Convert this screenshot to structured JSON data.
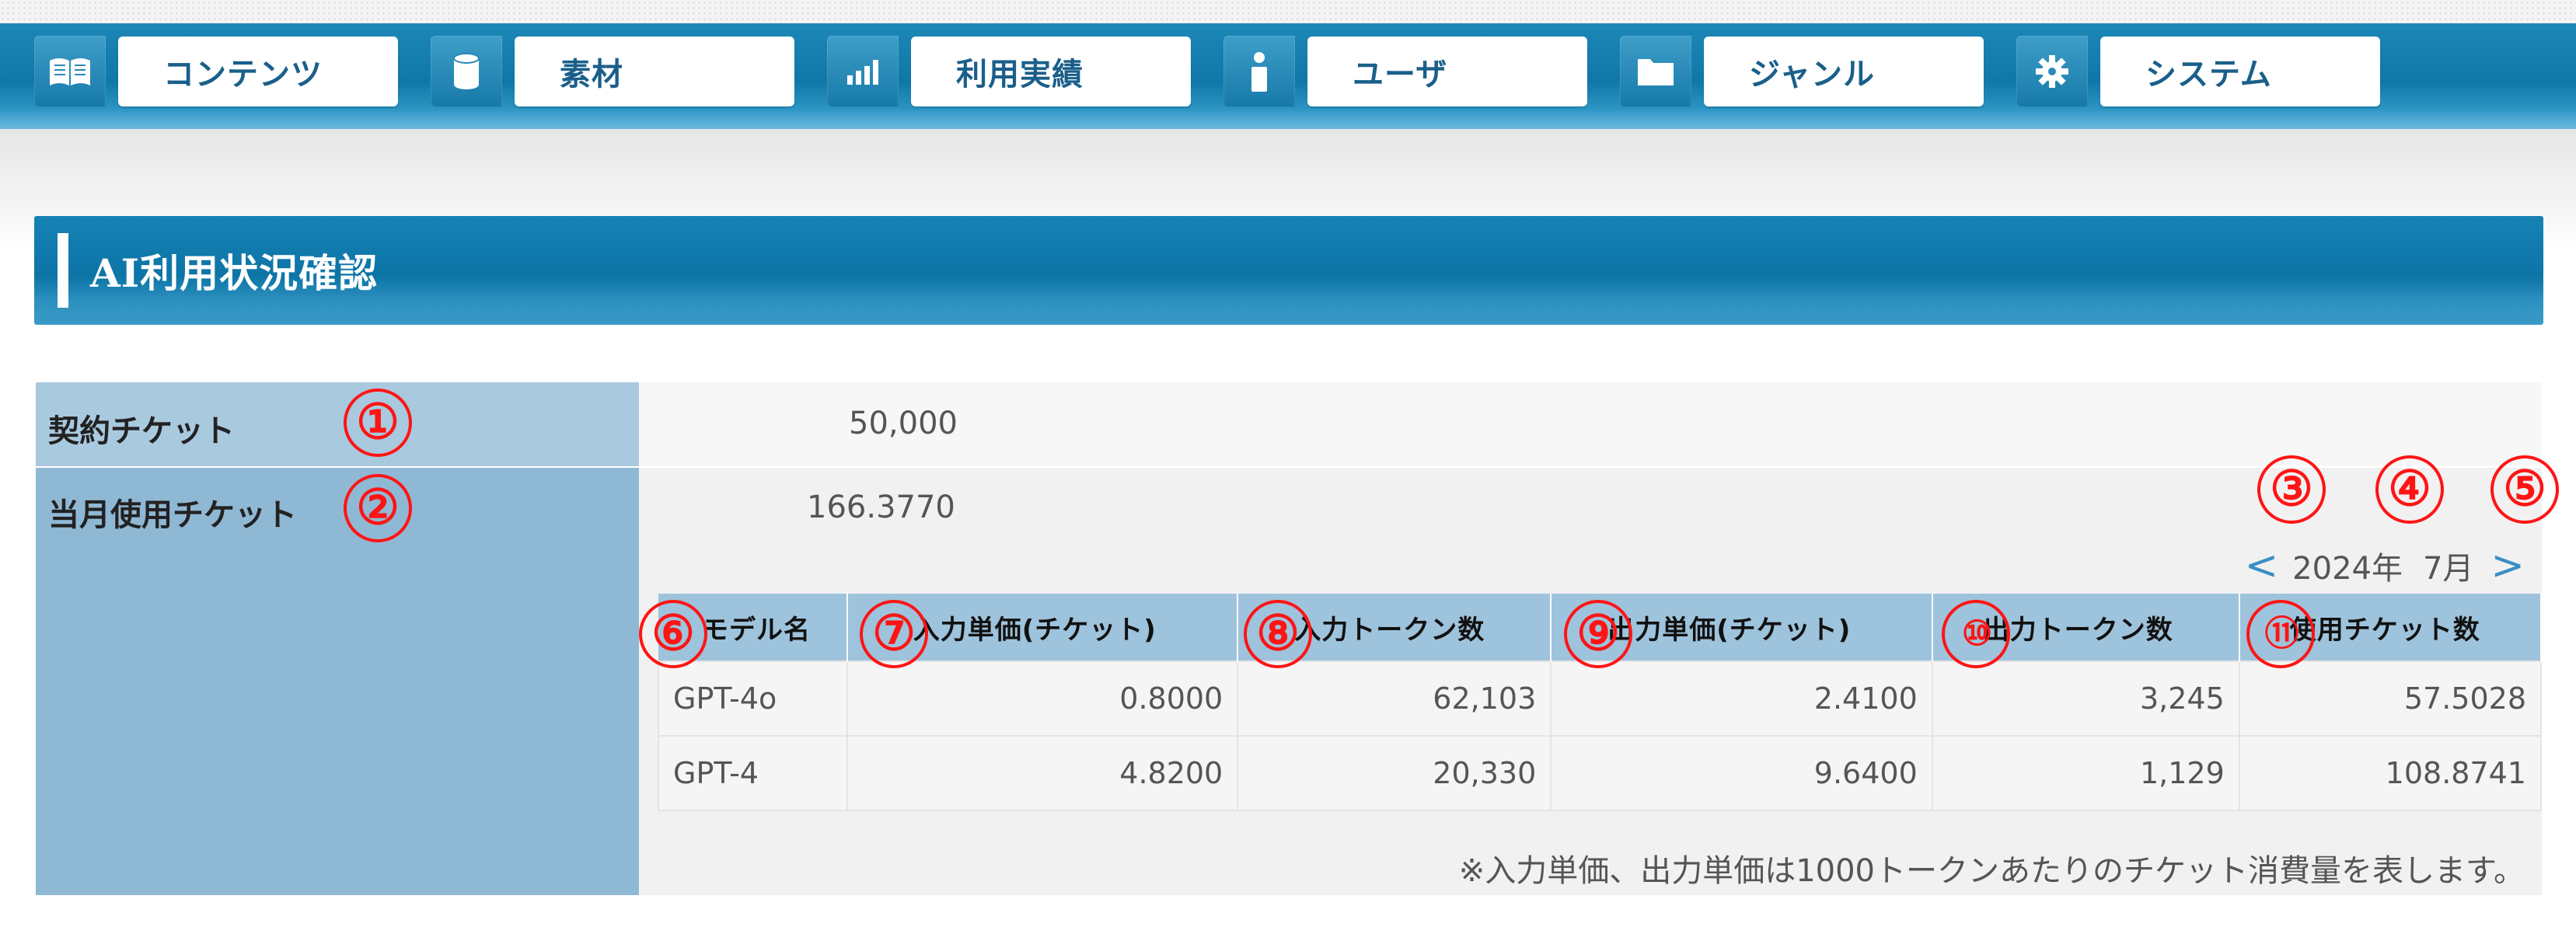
{
  "nav": {
    "items": [
      {
        "label": "コンテンツ",
        "icon": "book-icon"
      },
      {
        "label": "素材",
        "icon": "cylinder-icon"
      },
      {
        "label": "利用実績",
        "icon": "bar-chart-icon"
      },
      {
        "label": "ユーザ",
        "icon": "user-icon"
      },
      {
        "label": "ジャンル",
        "icon": "folder-icon"
      },
      {
        "label": "システム",
        "icon": "gear-icon"
      }
    ]
  },
  "page": {
    "title": "AI利用状況確認"
  },
  "summary": {
    "contract_label": "契約チケット",
    "contract_value": "50,000",
    "monthly_label": "当月使用チケット",
    "monthly_value": "166.3770"
  },
  "month_nav": {
    "prev": "<",
    "year": "2024年",
    "month": "7月",
    "next": ">"
  },
  "annotations": [
    "①",
    "②",
    "③",
    "④",
    "⑤",
    "⑥",
    "⑦",
    "⑧",
    "⑨",
    "⑩",
    "⑪"
  ],
  "table": {
    "headers": [
      "モデル名",
      "入力単価(チケット)",
      "入力トークン数",
      "出力単価(チケット)",
      "出力トークン数",
      "使用チケット数"
    ],
    "rows": [
      [
        "GPT-4o",
        "0.8000",
        "62,103",
        "2.4100",
        "3,245",
        "57.5028"
      ],
      [
        "GPT-4",
        "4.8200",
        "20,330",
        "9.6400",
        "1,129",
        "108.8741"
      ]
    ]
  },
  "footnote": "※入力単価、出力単価は1000トークンあたりのチケット消費量を表します。",
  "colors": {
    "nav_blue": "#0f78a8",
    "label_blue": "#8fb8d4",
    "annotation_red": "#ff1414"
  }
}
